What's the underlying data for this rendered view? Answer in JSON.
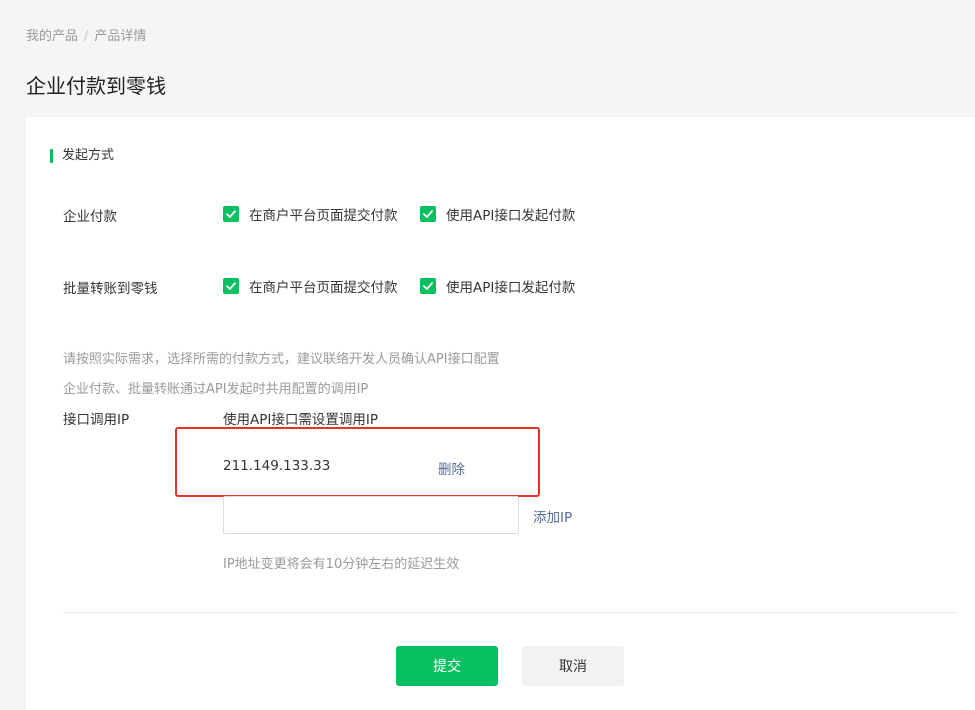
{
  "breadcrumb": {
    "items": [
      "我的产品",
      "产品详情"
    ],
    "separator": "/"
  },
  "page_title": "企业付款到零钱",
  "section": {
    "title": "发起方式"
  },
  "rows": [
    {
      "label": "企业付款",
      "options": [
        {
          "label": "在商户平台页面提交付款",
          "checked": true
        },
        {
          "label": "使用API接口发起付款",
          "checked": true
        }
      ]
    },
    {
      "label": "批量转账到零钱",
      "options": [
        {
          "label": "在商户平台页面提交付款",
          "checked": true
        },
        {
          "label": "使用API接口发起付款",
          "checked": true
        }
      ]
    }
  ],
  "hints": [
    "请按照实际需求，选择所需的付款方式，建议联络开发人员确认API接口配置",
    "企业付款、批量转账通过API发起时共用配置的调用IP"
  ],
  "ip": {
    "label": "接口调用IP",
    "requirement": "使用API接口需设置调用IP",
    "entries": [
      {
        "value": "211.149.133.33",
        "delete_label": "删除"
      }
    ],
    "input_value": "",
    "add_label": "添加IP",
    "note": "IP地址变更将会有10分钟左右的延迟生效"
  },
  "actions": {
    "submit_label": "提交",
    "cancel_label": "取消"
  },
  "colors": {
    "accent": "#07c160",
    "link": "#576b95",
    "highlight": "#e5332b"
  }
}
